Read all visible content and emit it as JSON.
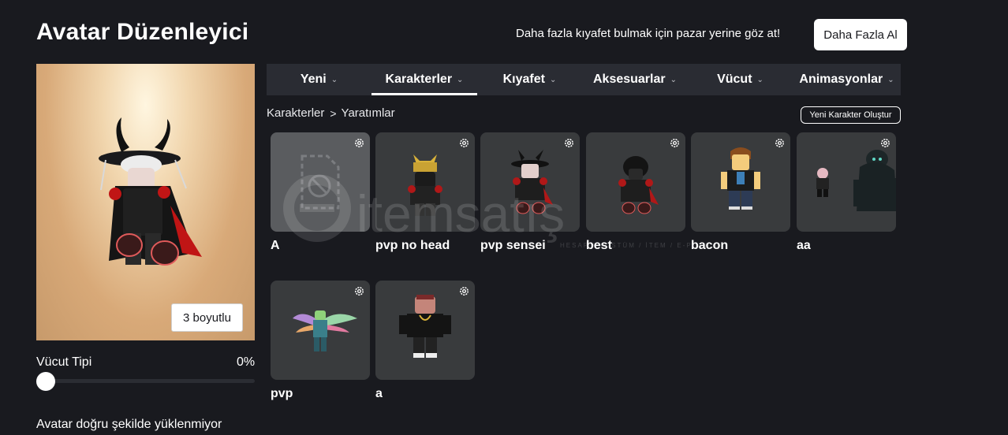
{
  "header": {
    "title": "Avatar Düzenleyici",
    "promo_text": "Daha fazla kıyafet bulmak için pazar yerine göz at!",
    "get_more_button": "Daha Fazla Al"
  },
  "preview": {
    "view_3d_button": "3 boyutlu"
  },
  "body_type": {
    "label": "Vücut Tipi",
    "value": "0%"
  },
  "warning": "Avatar doğru şekilde yüklenmiyor",
  "tabs": [
    {
      "label": "Yeni",
      "active": false
    },
    {
      "label": "Karakterler",
      "active": true
    },
    {
      "label": "Kıyafet",
      "active": false
    },
    {
      "label": "Aksesuarlar",
      "active": false
    },
    {
      "label": "Vücut",
      "active": false
    },
    {
      "label": "Animasyonlar",
      "active": false
    }
  ],
  "breadcrumb": {
    "root": "Karakterler",
    "separator": ">",
    "current": "Yaratımlar"
  },
  "new_character_button": "Yeni Karakter Oluştur",
  "characters": [
    {
      "name": "A",
      "thumbnail": "placeholder-icon"
    },
    {
      "name": "pvp no head",
      "thumbnail": "avatar-horned-gold-hat"
    },
    {
      "name": "pvp sensei",
      "thumbnail": "avatar-black-samurai"
    },
    {
      "name": "best",
      "thumbnail": "avatar-black-hood"
    },
    {
      "name": "bacon",
      "thumbnail": "avatar-bacon-hair"
    },
    {
      "name": "aa",
      "thumbnail": "avatar-dark-monster"
    },
    {
      "name": "pvp",
      "thumbnail": "avatar-rainbow-wings"
    },
    {
      "name": "a",
      "thumbnail": "avatar-pink-head-black-shirt"
    }
  ],
  "watermark": {
    "brand": "itemsatış",
    "tagline": "HESAP / KOSTÜM / İTEM / E-PİN / .COM"
  },
  "colors": {
    "background": "#191a1f",
    "tabbar": "#2a2c33",
    "card": "#393b3d",
    "placeholder_card": "#5a5c5f",
    "accent_white": "#ffffff"
  }
}
